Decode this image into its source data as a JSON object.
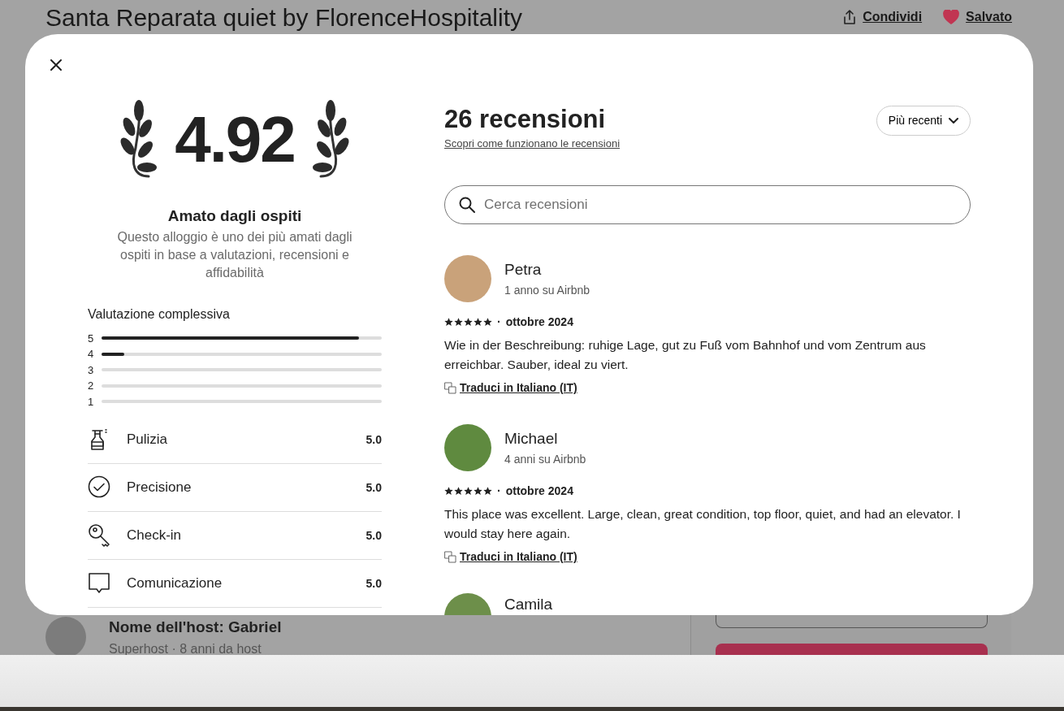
{
  "page": {
    "title": "Santa Reparata quiet by FlorenceHospitality",
    "share": "Condividi",
    "save": {
      "label": "Salvato",
      "saved": true
    }
  },
  "host": {
    "name": "Nome dell'host: Gabriel",
    "subtitle": "Superhost · 8 anni da host"
  },
  "modal": {
    "rating": "4.92",
    "badge_title": "Amato dagli ospiti",
    "badge_text": "Questo alloggio è uno dei più amati dagli ospiti in base a valutazioni, recensioni e affidabilità",
    "overall_label": "Valutazione complessiva",
    "distribution": [
      {
        "label": "5",
        "level": 0.92
      },
      {
        "label": "4",
        "level": 0.08
      },
      {
        "label": "3"
      },
      {
        "label": "2"
      },
      {
        "label": "1"
      }
    ],
    "categories": [
      {
        "kind": "cleaning",
        "label": "Pulizia",
        "score": "5.0"
      },
      {
        "kind": "accuracy",
        "label": "Precisione",
        "score": "5.0"
      },
      {
        "kind": "checkin",
        "label": "Check-in",
        "score": "5.0"
      },
      {
        "kind": "communication",
        "label": "Comunicazione",
        "score": "5.0"
      }
    ],
    "reviews_title": "26 recensioni",
    "reviews_link": "Scopri come funzionano le recensioni",
    "sort": "Più recenti",
    "search": {
      "placeholder": "Cerca recensioni"
    },
    "reviews": [
      {
        "name": "Petra",
        "tenure": "1 anno su Airbnb",
        "stars": 5,
        "separator": "·",
        "date": "ottobre 2024",
        "text": "Wie in der Beschreibung: ruhige Lage, gut zu Fuß vom Bahnhof und vom Zentrum aus erreichbar. Sauber, ideal zu viert.",
        "translate": "Traduci in Italiano (IT)"
      },
      {
        "name": "Michael",
        "tenure": "4 anni su Airbnb",
        "stars": 5,
        "separator": "·",
        "date": "ottobre 2024",
        "text": "This place was excellent.  Large, clean, great condition, top floor, quiet, and had an elevator.  I would stay here again.",
        "translate": "Traduci in Italiano (IT)"
      },
      {
        "name": "Camila"
      }
    ]
  }
}
